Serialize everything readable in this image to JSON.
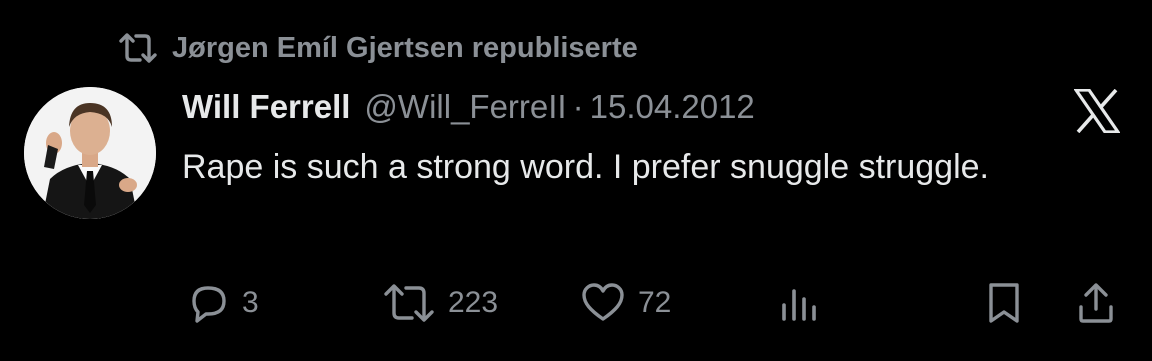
{
  "repost_banner": {
    "text": "Jørgen Emíl Gjertsen republiserte",
    "icon": "repost-icon"
  },
  "tweet": {
    "display_name": "Will Ferrell",
    "handle": "@Will_FerreII",
    "separator": "·",
    "date": "15.04.2012",
    "text": "Rape is such a strong word. I prefer snuggle struggle.",
    "avatar": "avatar-photo"
  },
  "actions": {
    "reply": {
      "icon": "reply-icon",
      "count": "3"
    },
    "repost": {
      "icon": "repost-icon",
      "count": "223"
    },
    "like": {
      "icon": "heart-icon",
      "count": "72"
    },
    "views": {
      "icon": "views-icon"
    },
    "bookmark": {
      "icon": "bookmark-icon"
    },
    "share": {
      "icon": "share-icon"
    }
  },
  "colors": {
    "background": "#000000",
    "primary_text": "#e7e9ea",
    "secondary_text": "#8b9096"
  }
}
